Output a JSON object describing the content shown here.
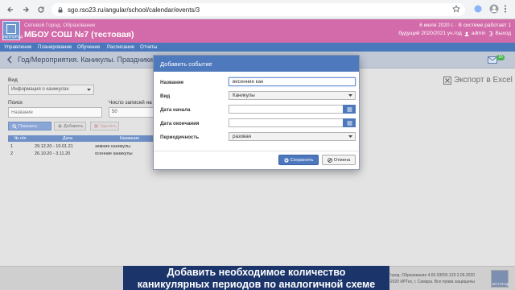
{
  "browser": {
    "url": "sgo.rso23.ru/angular/school/calendar/events/3"
  },
  "header": {
    "logo_text": "НЕТГОРОД",
    "city": "Сетевой Город. Образование",
    "school": "МБОУ СОШ №7 (тестовая)",
    "date_line": "6 июля 2020 г. · В системе работает 1",
    "year_label": "будущий 2020/2021 уч.год",
    "user_label": "admin",
    "exit_label": "Выход"
  },
  "menu": [
    "Управление",
    "Планирование",
    "Обучение",
    "Расписание",
    "Отчеты"
  ],
  "page": {
    "title": "Год/Мероприятия. Каникулы. Праздники",
    "view_label": "Вид",
    "view_value": "Информация о каникулах",
    "search_label": "Поиск",
    "search_placeholder": "Название",
    "per_page_label": "Число записей на стр",
    "per_page_value": "50",
    "show_button": "Показать",
    "add_button": "Добавить",
    "delete_button": "Удалить",
    "export_label": "Экспорт в Excel",
    "table": {
      "headers": [
        "№ п/п",
        "Дата",
        "Название"
      ],
      "rows": [
        {
          "num": "1",
          "date": "29.12.20 - 10.01.21",
          "name": "зимние каникулы"
        },
        {
          "num": "2",
          "date": "26.10.20 - 3.11.20",
          "name": "осенние каникулы"
        }
      ]
    },
    "mail_count": "16"
  },
  "modal": {
    "title": "Добавить событие",
    "fields": {
      "name_label": "Название",
      "name_value": "весенние кан",
      "type_label": "Вид",
      "type_value": "Каникулы",
      "start_label": "Дата начала",
      "start_value": "",
      "end_label": "Дата окончания",
      "end_value": "",
      "period_label": "Периодичность",
      "period_value": "разовая"
    },
    "save_button": "Сохранить",
    "cancel_button": "Отмена"
  },
  "footer": {
    "line1": "Сетевой Город. Образование  4.60.53055.129  2.06.2020",
    "line2": "© 2003–2020 ИРТех, г. Самара. Все права защищены"
  },
  "caption": {
    "line1": "Добавить необходимое количество",
    "line2": "каникулярных периодов по аналогичной схеме"
  },
  "colors": {
    "header_pink": "#d36aa9",
    "menu_blue": "#4a78bd",
    "modal_header": "#4f79bd",
    "caption_bg": "#1b356b"
  }
}
